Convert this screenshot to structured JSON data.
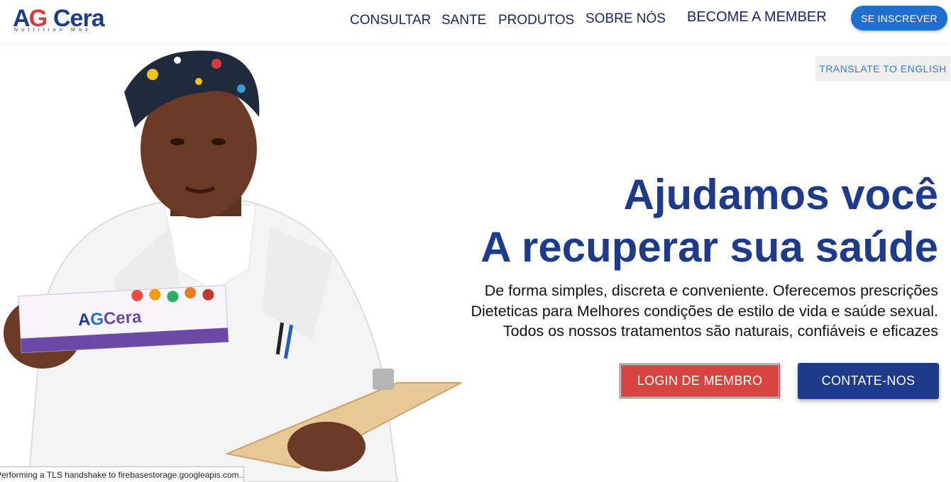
{
  "brand": {
    "logo_ag_a": "A",
    "logo_ag_g": "G",
    "logo_cera": "Cera",
    "logo_sub": "Nutrition Moz"
  },
  "nav": {
    "items": [
      {
        "label": "CONSULTAR"
      },
      {
        "label": "SANTE"
      },
      {
        "label": "PRODUTOS"
      },
      {
        "label": "SOBRE NÓS"
      },
      {
        "label": "BECOME A MEMBER"
      }
    ],
    "subscribe_label": "SE INSCREVER"
  },
  "translate_label": "TRANSLATE TO ENGLISH",
  "hero": {
    "title_line1": "Ajudamos você",
    "title_line2": "A recuperar sua saúde",
    "text_line1": "De forma simples, discreta e conveniente. Oferecemos prescrições",
    "text_line2": "Dieteticas para Melhores condições de estilo de vida e saúde sexual.",
    "text_line3": "Todos os nossos tratamentos são naturais, confiáveis e eficazes",
    "login_label": "LOGIN DE MEMBRO",
    "contact_label": "CONTATE-NOS"
  },
  "product_box": {
    "brand_a": "A",
    "brand_g": "G",
    "brand_cera": "Cera"
  },
  "status_bar": "Performing a TLS handshake to firebasestorage.googleapis.com...",
  "colors": {
    "primary": "#1e3a8a",
    "accent_red": "#d9443f",
    "subscribe_blue": "#1f6fd1",
    "translate_text": "#3a7bd5"
  }
}
